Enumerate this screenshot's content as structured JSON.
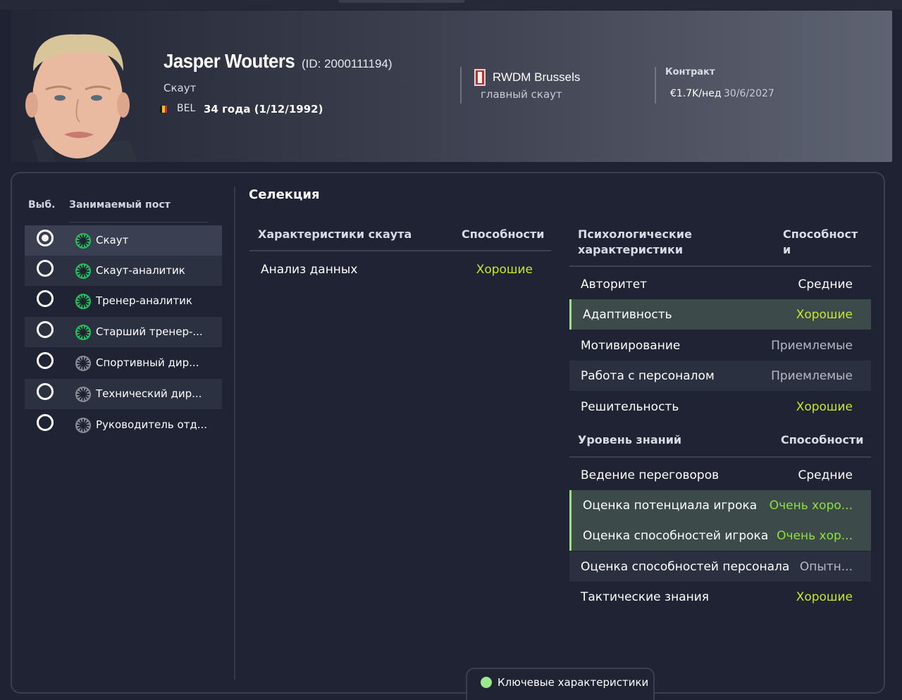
{
  "header": {
    "name": "Jasper Wouters",
    "id_text": "(ID: 2000111194)",
    "role": "Скаут",
    "nationality": "BEL",
    "age_text": "34 года (1/12/1992)",
    "club": "RWDM Brussels",
    "club_role": "главный скаут",
    "contract_label": "Контракт",
    "wage": "€1.7K/нед",
    "contract_end": "30/6/2027"
  },
  "positions": {
    "col_select": "Выб.",
    "col_post": "Занимаемый пост",
    "items": [
      {
        "label": "Скаут",
        "icon": "green-star-icon",
        "selected": true
      },
      {
        "label": "Скаут-аналитик",
        "icon": "green-star-icon",
        "selected": false
      },
      {
        "label": "Тренер-аналитик",
        "icon": "green-star-icon",
        "selected": false
      },
      {
        "label": "Старший тренер-...",
        "icon": "green-star-icon",
        "selected": false
      },
      {
        "label": "Спортивный дир...",
        "icon": "grey-star-icon",
        "selected": false
      },
      {
        "label": "Технический дир...",
        "icon": "grey-star-icon",
        "selected": false
      },
      {
        "label": "Руководитель отд...",
        "icon": "grey-star-icon",
        "selected": false
      }
    ]
  },
  "selection": {
    "title": "Селекция",
    "scout": {
      "head_attr": "Характеристики скаута",
      "head_val": "Способности",
      "rows": [
        {
          "name": "Анализ данных",
          "value": "Хорошие"
        }
      ]
    },
    "psych": {
      "head_attr": "Психологические характеристики",
      "head_val": "Способности",
      "rows": [
        {
          "name": "Авторитет",
          "value": "Средние"
        },
        {
          "name": "Адаптивность",
          "value": "Хорошие"
        },
        {
          "name": "Мотивирование",
          "value": "Приемлемые"
        },
        {
          "name": "Работа с персоналом",
          "value": "Приемлемые"
        },
        {
          "name": "Решительность",
          "value": "Хорошие"
        }
      ]
    },
    "knowledge": {
      "head_attr": "Уровень знаний",
      "head_val": "Способности",
      "rows": [
        {
          "name": "Ведение переговоров",
          "value": "Средние"
        },
        {
          "name": "Оценка потенциала игрока",
          "value": "Очень хоро..."
        },
        {
          "name": "Оценка способностей игрока",
          "value": "Очень хор..."
        },
        {
          "name": "Оценка способностей персонала",
          "value": "Опытн..."
        },
        {
          "name": "Тактические знания",
          "value": "Хорошие"
        }
      ]
    }
  },
  "bottom_tab": {
    "label": "Ключевые характеристики"
  },
  "colors": {
    "good": "#c7e82a",
    "very_good": "#8fe040",
    "highlight_bar": "#9be07a",
    "accent_dot": "#9be88f"
  }
}
